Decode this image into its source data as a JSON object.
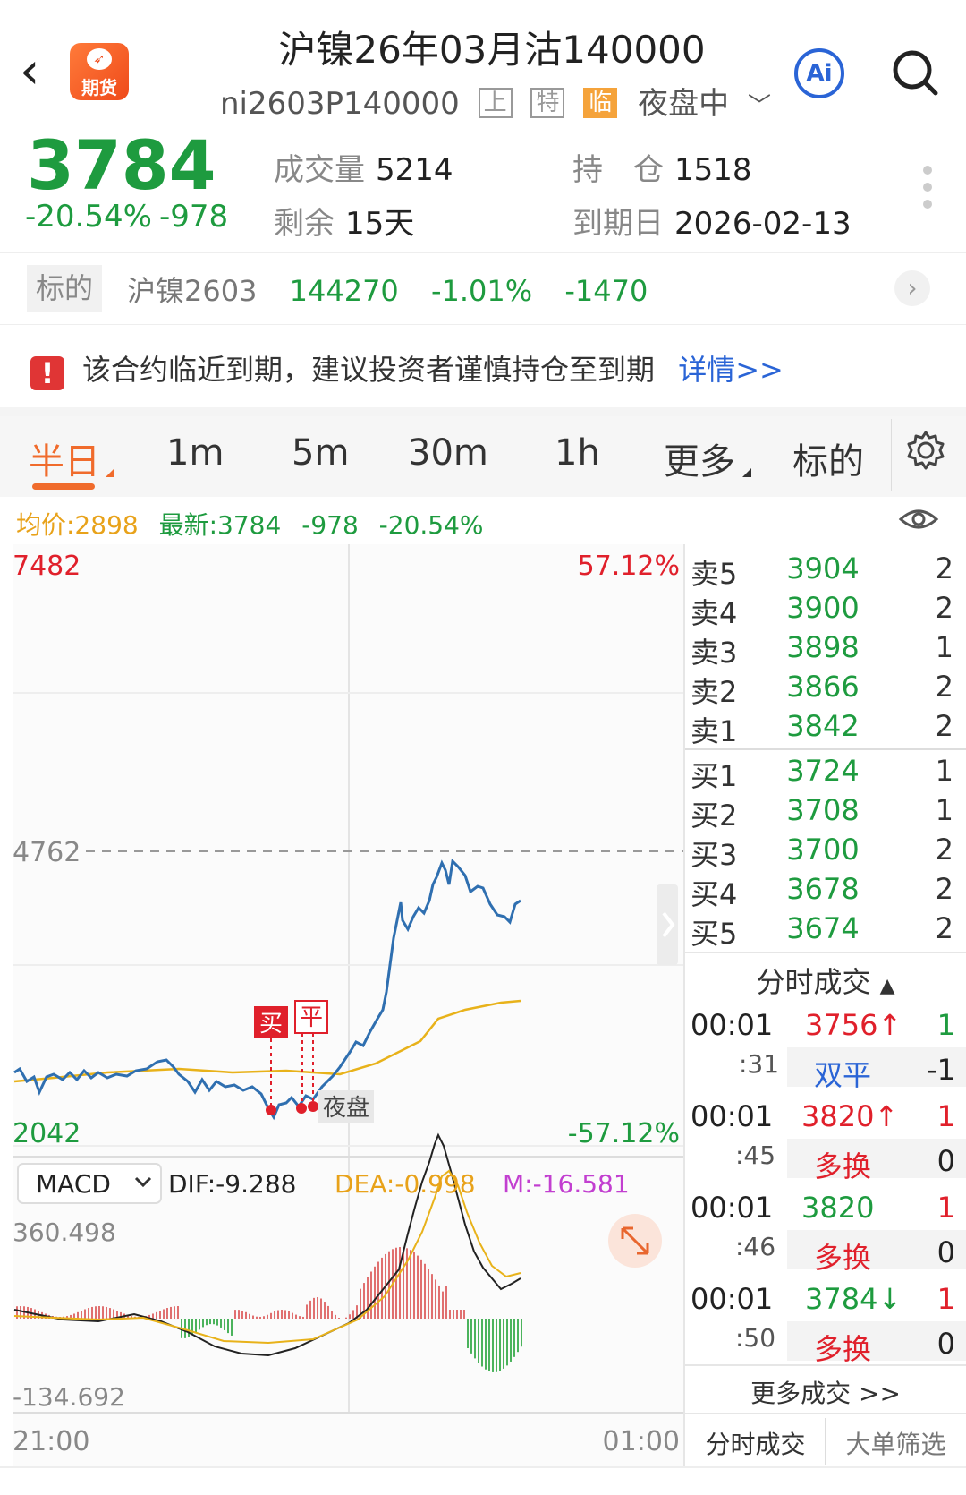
{
  "header": {
    "back": "‹",
    "logo_text": "期货",
    "title": "沪镍26年03月沽140000",
    "code": "ni2603P140000",
    "tags": [
      "上",
      "特",
      "临"
    ],
    "session": "夜盘中",
    "ai_label": "Ai"
  },
  "quote": {
    "price": "3784",
    "pct": "-20.54%",
    "change": "-978",
    "volume_label": "成交量",
    "volume": "5214",
    "position_label": "持　仓",
    "position": "1518",
    "remaining_label": "剩余",
    "remaining": "15天",
    "expiry_label": "到期日",
    "expiry": "2026-02-13"
  },
  "underlying": {
    "tag": "标的",
    "name": "沪镍2603",
    "price": "144270",
    "pct": "-1.01%",
    "change": "-1470"
  },
  "warning": {
    "text": "该合约临近到期，建议投资者谨慎持仓至到期",
    "link": "详情>>"
  },
  "tabs": [
    "半日",
    "1m",
    "5m",
    "30m",
    "1h",
    "更多",
    "标的"
  ],
  "info_line": {
    "avg": "均价:2898",
    "latest": "最新:3784",
    "change": "-978",
    "pct": "-20.54%"
  },
  "chart": {
    "y_top": "7482",
    "y_mid": "4762",
    "y_bottom": "2042",
    "pct_top": "57.12%",
    "pct_bottom": "-57.12%",
    "night_label": "夜盘",
    "buy_marker": "买",
    "close_marker": "平",
    "macd_select": "MACD",
    "dif": "DIF:-9.288",
    "dea": "DEA:-0.998",
    "m": "M:-16.581",
    "macd_top": "360.498",
    "macd_bottom": "-134.692",
    "x_start": "21:00",
    "x_end": "01:00"
  },
  "order_book": {
    "asks": [
      {
        "label": "卖5",
        "price": "3904",
        "vol": "2"
      },
      {
        "label": "卖4",
        "price": "3900",
        "vol": "2"
      },
      {
        "label": "卖3",
        "price": "3898",
        "vol": "1"
      },
      {
        "label": "卖2",
        "price": "3866",
        "vol": "2"
      },
      {
        "label": "卖1",
        "price": "3842",
        "vol": "2"
      }
    ],
    "bids": [
      {
        "label": "买1",
        "price": "3724",
        "vol": "1"
      },
      {
        "label": "买2",
        "price": "3708",
        "vol": "1"
      },
      {
        "label": "买3",
        "price": "3700",
        "vol": "2"
      },
      {
        "label": "买4",
        "price": "3678",
        "vol": "2"
      },
      {
        "label": "买5",
        "price": "3674",
        "vol": "2"
      }
    ]
  },
  "ticks": {
    "title": "分时成交",
    "rows": [
      {
        "time": "00:01",
        "sec": ":31",
        "price": "3756↑",
        "vol": "1",
        "type": "双平",
        "oi": "-1"
      },
      {
        "time": "00:01",
        "sec": ":45",
        "price": "3820↑",
        "vol": "1",
        "type": "多换",
        "oi": "0"
      },
      {
        "time": "00:01",
        "sec": ":46",
        "price": "3820",
        "vol": "1",
        "type": "多换",
        "oi": "0"
      },
      {
        "time": "00:01",
        "sec": ":50",
        "price": "3784↓",
        "vol": "1",
        "type": "多换",
        "oi": "0"
      }
    ],
    "more": "更多成交 >>",
    "tab1": "分时成交",
    "tab2": "大单筛选"
  }
}
